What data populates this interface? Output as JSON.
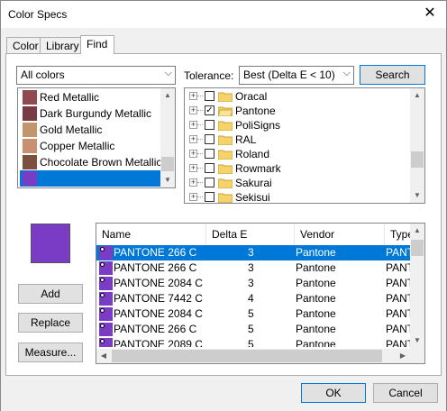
{
  "window": {
    "title": "Color Specs",
    "close_glyph": "✕"
  },
  "tabs": [
    {
      "label": "Color",
      "active": false
    },
    {
      "label": "Library",
      "active": false
    },
    {
      "label": "Find",
      "active": true
    }
  ],
  "filter": {
    "value": "All colors"
  },
  "tolerance": {
    "label": "Tolerance:",
    "value": "Best (Delta E < 10)"
  },
  "search_button": "Search",
  "color_list": {
    "items": [
      {
        "name": "Red Metallic",
        "color": "#8e4a4e"
      },
      {
        "name": "Dark Burgundy Metallic",
        "color": "#7a3a44"
      },
      {
        "name": "Gold Metallic",
        "color": "#c2956b"
      },
      {
        "name": "Copper Metallic",
        "color": "#c89070"
      },
      {
        "name": "Chocolate Brown Metallic",
        "color": "#7d5040"
      },
      {
        "name": "",
        "color": "#7a3cc4",
        "selected": true
      }
    ]
  },
  "libraries": [
    {
      "name": "Oracal",
      "checked": false
    },
    {
      "name": "Pantone",
      "checked": true
    },
    {
      "name": "PoliSigns",
      "checked": false
    },
    {
      "name": "RAL",
      "checked": false
    },
    {
      "name": "Roland",
      "checked": false
    },
    {
      "name": "Rowmark",
      "checked": false
    },
    {
      "name": "Sakurai",
      "checked": false
    },
    {
      "name": "Sekisui",
      "checked": false
    }
  ],
  "current_color": "#7a3cc4",
  "actions": {
    "add": "Add",
    "replace": "Replace",
    "measure": "Measure..."
  },
  "results": {
    "columns": [
      "Name",
      "Delta E",
      "Vendor",
      "Type"
    ],
    "rows": [
      {
        "name": "PANTONE 266 C",
        "delta": "3",
        "vendor": "Pantone",
        "type": "PANT",
        "selected": true
      },
      {
        "name": "PANTONE 266 C",
        "delta": "3",
        "vendor": "Pantone",
        "type": "PANT"
      },
      {
        "name": "PANTONE 2084 C",
        "delta": "3",
        "vendor": "Pantone",
        "type": "PANT"
      },
      {
        "name": "PANTONE 7442 C",
        "delta": "4",
        "vendor": "Pantone",
        "type": "PANT"
      },
      {
        "name": "PANTONE 2084 C",
        "delta": "5",
        "vendor": "Pantone",
        "type": "PANT"
      },
      {
        "name": "PANTONE 266 C",
        "delta": "5",
        "vendor": "Pantone",
        "type": "PANT"
      },
      {
        "name": "PANTONE 2089 C",
        "delta": "5",
        "vendor": "Pantone",
        "type": "PANT"
      }
    ]
  },
  "footer": {
    "ok": "OK",
    "cancel": "Cancel"
  },
  "colors": {
    "accent": "#0078d7",
    "swatch": "#7a3cc4",
    "folder": "#f5d36b"
  }
}
